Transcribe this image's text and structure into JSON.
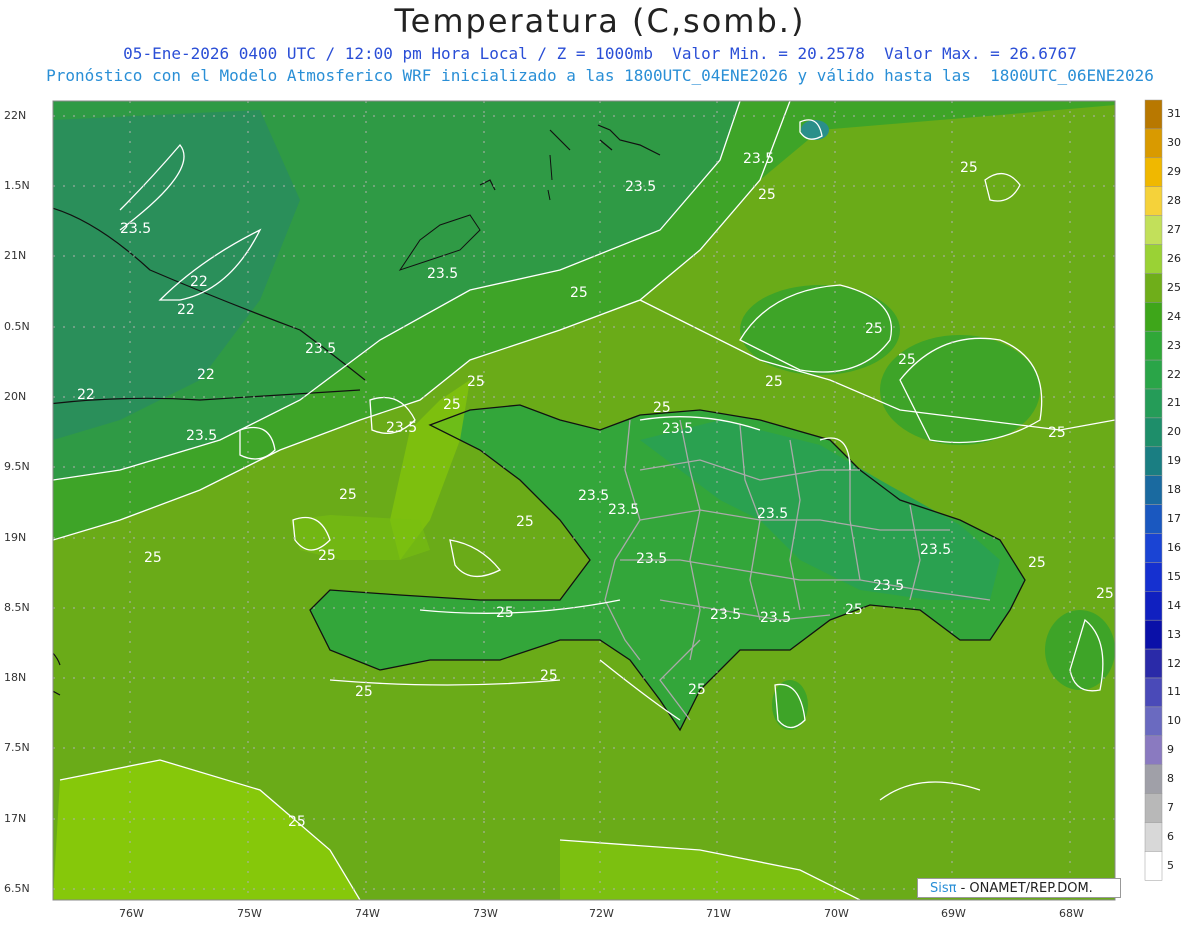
{
  "title": "Temperatura (C,somb.)",
  "subtitle_line1": "05-Ene-2026 0400 UTC / 12:00 pm Hora Local / Z = 1000mb  Valor Min. = 20.2578  Valor Max. = 26.6767",
  "subtitle_line2": "Pronóstico con el Modelo Atmosferico WRF inicializado a las 1800UTC_04ENE2026 y válido hasta las  1800UTC_06ENE2026",
  "lat_labels": [
    "22N",
    "1.5N",
    "21N",
    "0.5N",
    "20N",
    "9.5N",
    "19N",
    "8.5N",
    "18N",
    "7.5N",
    "17N",
    "6.5N"
  ],
  "lon_labels": [
    "76W",
    "75W",
    "74W",
    "73W",
    "72W",
    "71W",
    "70W",
    "69W",
    "68W"
  ],
  "colorbar": {
    "labels": [
      "31",
      "30",
      "29",
      "28",
      "27",
      "26",
      "25",
      "24",
      "23",
      "22",
      "21",
      "20",
      "19",
      "18",
      "17",
      "16",
      "15",
      "14",
      "13",
      "12",
      "11",
      "10",
      "9",
      "8",
      "7",
      "6",
      "5"
    ],
    "colors": [
      "#b87800",
      "#d99a00",
      "#f0b800",
      "#f5d23a",
      "#c2e05a",
      "#9ad235",
      "#6fae1a",
      "#3ea61a",
      "#30a838",
      "#2aa548",
      "#259c58",
      "#1e8e6a",
      "#1a7e82",
      "#1a6aa0",
      "#1a58c0",
      "#1a44d4",
      "#1530d0",
      "#1020c0",
      "#0a10a8",
      "#2a2aa8",
      "#4a4ab8",
      "#6a6ac0",
      "#8a7ac0",
      "#a0a0a8",
      "#b8b8b8",
      "#d8d8d8",
      "#ffffff"
    ]
  },
  "contour_labels": [
    "23.5",
    "25",
    "22"
  ],
  "credit": {
    "brand": "Sisπ",
    "text": " - ONAMET/REP.DOM."
  },
  "colors": {
    "ocean_dark": "#2f9a55",
    "mid_green": "#3aa62e",
    "light_green": "#6aaa18",
    "lime": "#86c80a",
    "border_gray": "#aaaaaa"
  }
}
